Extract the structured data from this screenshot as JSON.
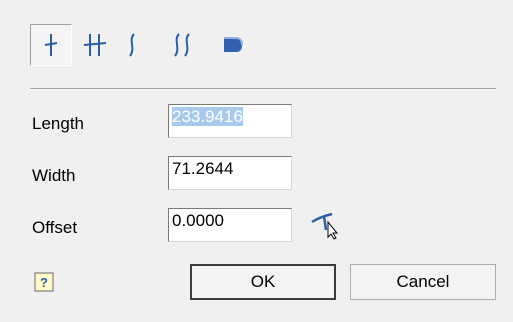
{
  "toolbar": {
    "tools": [
      {
        "icon": "single-line-icon",
        "active": true
      },
      {
        "icon": "double-line-icon",
        "active": false
      },
      {
        "icon": "single-curve-icon",
        "active": false
      },
      {
        "icon": "double-curve-icon",
        "active": false
      },
      {
        "icon": "solid-shape-icon",
        "active": false
      }
    ]
  },
  "fields": {
    "length": {
      "label": "Length",
      "value": "233.9416"
    },
    "width": {
      "label": "Width",
      "value": "71.2644"
    },
    "offset": {
      "label": "Offset",
      "value": "0.0000"
    }
  },
  "buttons": {
    "ok": "OK",
    "cancel": "Cancel"
  },
  "colors": {
    "selection": "#a8c8ec",
    "toolbar_icon": "#2a5fa8"
  }
}
